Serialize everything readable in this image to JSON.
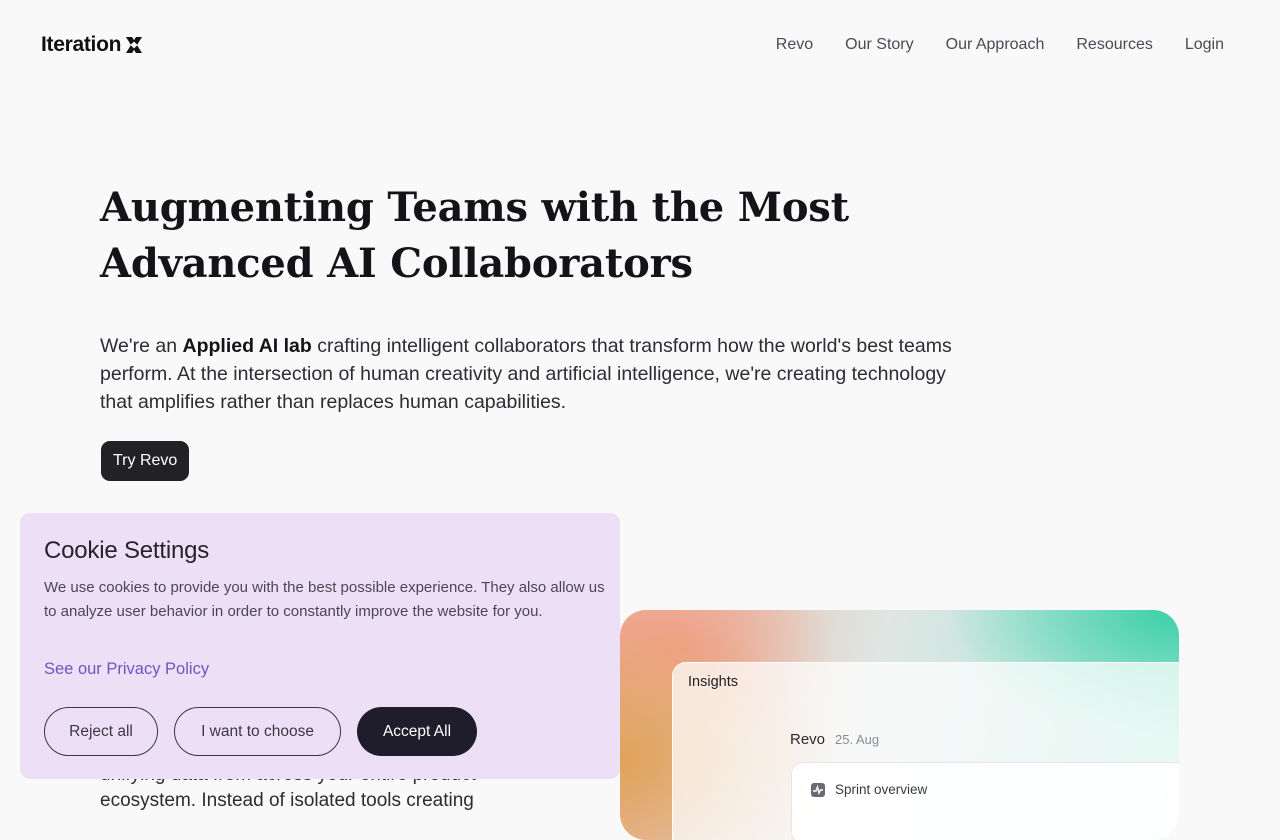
{
  "header": {
    "logo_text": "Iteration",
    "logo_icon": "x-mark-icon",
    "nav": [
      {
        "label": "Revo"
      },
      {
        "label": "Our Story"
      },
      {
        "label": "Our Approach"
      },
      {
        "label": "Resources"
      },
      {
        "label": "Login"
      }
    ]
  },
  "hero": {
    "title": "Augmenting Teams with the Most Advanced AI Collaborators",
    "desc_prefix": "We're an ",
    "desc_bold": "Applied AI lab",
    "desc_suffix": " crafting intelligent collaborators that transform how the world's best teams perform. At the intersection of human creativity and artificial intelligence, we're creating technology that amplifies rather than replaces human capabilities.",
    "cta_label": "Try Revo"
  },
  "under_text": "unifying data from across your entire product ecosystem. Instead of isolated tools creating",
  "preview": {
    "panel_title": "Insights",
    "sender": "Revo",
    "date": "25. Aug",
    "card_label": "Sprint overview",
    "card_icon": "activity-icon"
  },
  "cookie": {
    "title": "Cookie Settings",
    "text": "We use cookies to provide you with the best possible experience. They also allow us to analyze user behavior in order to constantly improve the website for you.",
    "privacy_link": "See our Privacy Policy",
    "reject_label": "Reject all",
    "choose_label": "I want to choose",
    "accept_label": "Accept All"
  },
  "colors": {
    "background": "#f9f9fa",
    "cta_bg": "#222126",
    "cookie_bg": "#ede0f6",
    "link": "#7551c0",
    "accept_bg": "#1f1c2b"
  }
}
